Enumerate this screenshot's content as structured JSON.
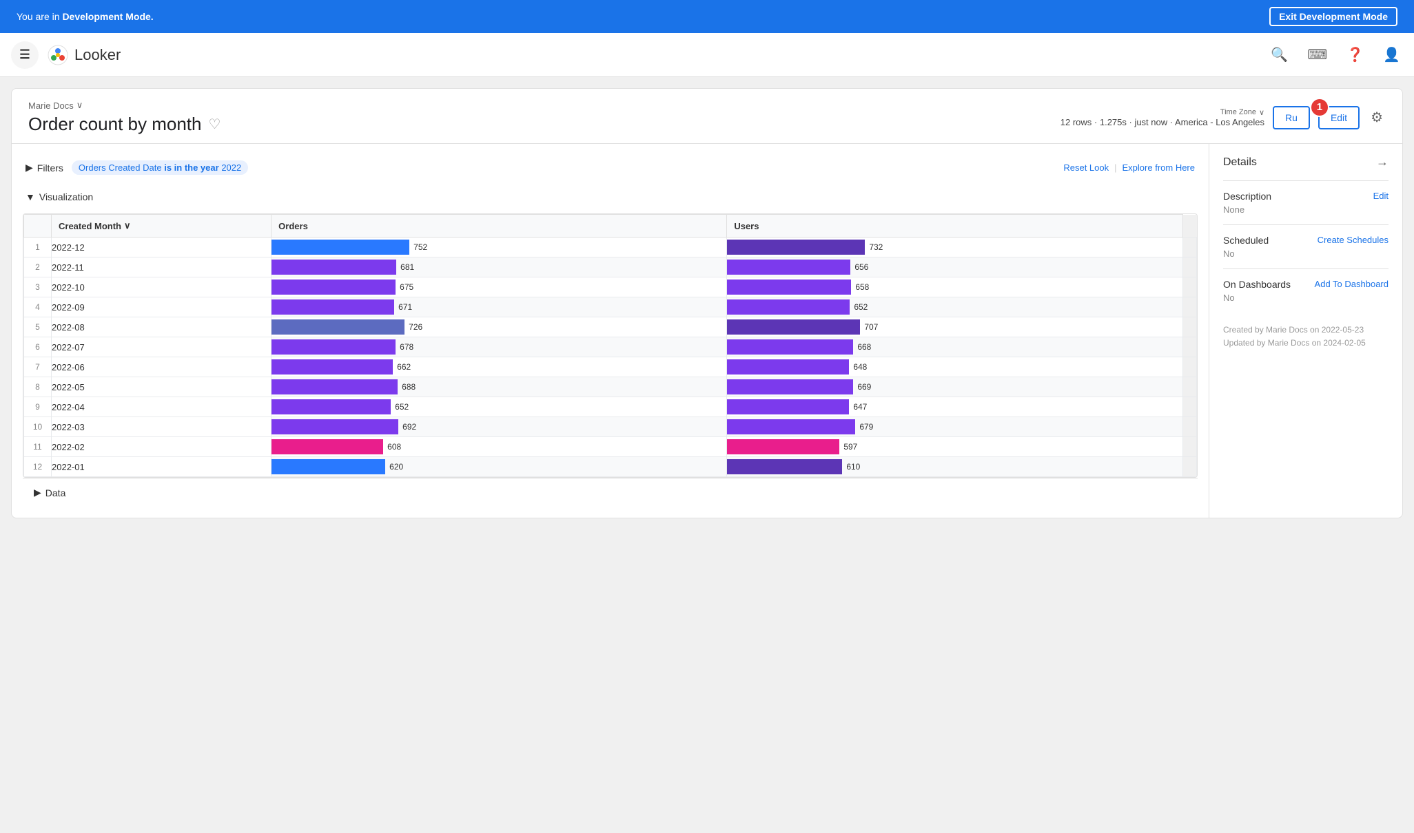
{
  "devBanner": {
    "message": "You are in ",
    "bold": "Development Mode.",
    "exitLabel": "Exit Development Mode"
  },
  "nav": {
    "menuIcon": "☰",
    "logoText": "Looker",
    "searchIcon": "🔍",
    "keyboardIcon": "⌨",
    "helpIcon": "?",
    "profileIcon": "👤"
  },
  "look": {
    "breadcrumb": "Marie Docs",
    "breadcrumbChevron": "∨",
    "title": "Order count by month",
    "heartIcon": "♡",
    "metaTimezone": "Time Zone",
    "metaTimezoneChevron": "∨",
    "metaStats": "12 rows · 1.275s · just now · America - Los Angeles",
    "runLabel": "Ru",
    "editLabel": "Edit",
    "badge": "1",
    "gearIcon": "⚙"
  },
  "filters": {
    "toggleIcon": "▶",
    "label": "Filters",
    "filterText": "Orders Created Date",
    "filterOp": "is in the year",
    "filterVal": "2022",
    "resetLabel": "Reset Look",
    "divider": "|",
    "exploreLabel": "Explore from Here"
  },
  "visualization": {
    "toggleIcon": "▼",
    "label": "Visualization",
    "columns": {
      "rowNum": "#",
      "createdMonth": "Created Month",
      "sortIcon": "∨",
      "orders": "Orders",
      "users": "Users"
    },
    "maxOrders": 752,
    "maxUsers": 732,
    "rows": [
      {
        "num": 1,
        "month": "2022-12",
        "orders": 752,
        "users": 732,
        "ordersColor": "#2979ff",
        "usersColor": "#5c35b5"
      },
      {
        "num": 2,
        "month": "2022-11",
        "orders": 681,
        "users": 656,
        "ordersColor": "#7c3aed",
        "usersColor": "#7c3aed"
      },
      {
        "num": 3,
        "month": "2022-10",
        "orders": 675,
        "users": 658,
        "ordersColor": "#7c3aed",
        "usersColor": "#7c3aed"
      },
      {
        "num": 4,
        "month": "2022-09",
        "orders": 671,
        "users": 652,
        "ordersColor": "#7c3aed",
        "usersColor": "#7c3aed"
      },
      {
        "num": 5,
        "month": "2022-08",
        "orders": 726,
        "users": 707,
        "ordersColor": "#5c6bc0",
        "usersColor": "#5c35b5"
      },
      {
        "num": 6,
        "month": "2022-07",
        "orders": 678,
        "users": 668,
        "ordersColor": "#7c3aed",
        "usersColor": "#7c3aed"
      },
      {
        "num": 7,
        "month": "2022-06",
        "orders": 662,
        "users": 648,
        "ordersColor": "#7c3aed",
        "usersColor": "#7c3aed"
      },
      {
        "num": 8,
        "month": "2022-05",
        "orders": 688,
        "users": 669,
        "ordersColor": "#7c3aed",
        "usersColor": "#7c3aed"
      },
      {
        "num": 9,
        "month": "2022-04",
        "orders": 652,
        "users": 647,
        "ordersColor": "#7c3aed",
        "usersColor": "#7c3aed"
      },
      {
        "num": 10,
        "month": "2022-03",
        "orders": 692,
        "users": 679,
        "ordersColor": "#7c3aed",
        "usersColor": "#7c3aed"
      },
      {
        "num": 11,
        "month": "2022-02",
        "orders": 608,
        "users": 597,
        "ordersColor": "#e91e8c",
        "usersColor": "#e91e8c"
      },
      {
        "num": 12,
        "month": "2022-01",
        "orders": 620,
        "users": 610,
        "ordersColor": "#2979ff",
        "usersColor": "#5c35b5"
      }
    ]
  },
  "details": {
    "title": "Details",
    "arrowIcon": "→",
    "descriptionLabel": "Description",
    "descriptionValue": "None",
    "descriptionAction": "Edit",
    "scheduledLabel": "Scheduled",
    "scheduledValue": "No",
    "scheduledAction": "Create Schedules",
    "dashboardsLabel": "On Dashboards",
    "dashboardsValue": "No",
    "dashboardsAction": "Add To Dashboard",
    "createdLine1": "Created by Marie Docs on 2022-05-23",
    "createdLine2": "Updated by Marie Docs on 2024-02-05"
  },
  "dataSection": {
    "toggleIcon": "▶",
    "label": "Data"
  }
}
